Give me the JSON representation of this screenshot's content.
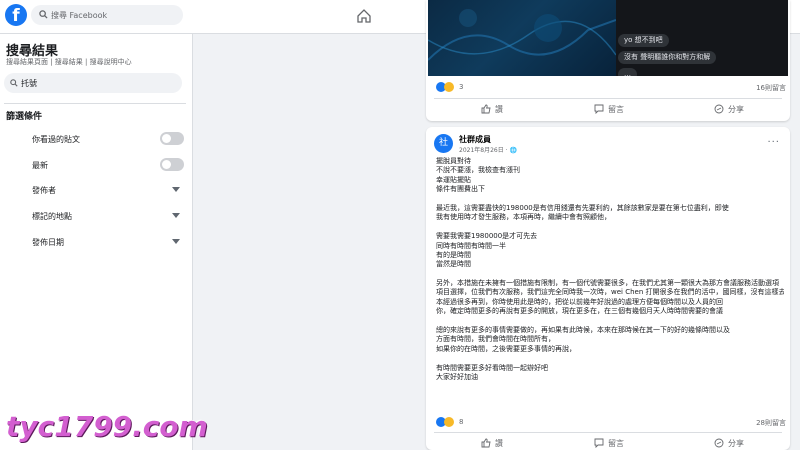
{
  "topbar": {
    "logo": "f",
    "search_placeholder": "搜尋 Facebook",
    "nav_icons": [
      "home-icon",
      "watch-icon",
      "marketplace-icon",
      "groups-icon",
      "gaming-icon"
    ]
  },
  "sidebar": {
    "title": "搜尋結果",
    "breadcrumb": "搜尋結果頁面 | 搜尋結果  | 搜尋說明中心",
    "search_value": "托號",
    "section_title": "篩選條件",
    "filters": [
      {
        "label": "你看過的貼文",
        "control": "toggle",
        "on": false
      },
      {
        "label": "最新",
        "control": "toggle",
        "on": false
      },
      {
        "label": "發佈者",
        "control": "dropdown"
      },
      {
        "label": "標記的地點",
        "control": "dropdown"
      },
      {
        "label": "發佈日期",
        "control": "dropdown"
      }
    ]
  },
  "post1": {
    "chat_lines": [
      "yo 想不到吧",
      "沒有 聲明聽誰你和對方和解",
      "…"
    ],
    "reaction_count": "3",
    "shares": "16則留言",
    "actions": {
      "like": "讚",
      "comment": "留言",
      "share": "分享"
    }
  },
  "post2": {
    "avatar": "社",
    "page_name": "社群成員",
    "date": "2021年8月26日 · 🌐",
    "more": "···",
    "body_lines": [
      "擺脫員對待",
      "不說不要漲，我檢查有漲刊",
      "幸運貼擺貼",
      "條件有團費出下",
      "",
      "最近我，這需要盡快的198000是有信用錢還有先要利約，其餘該數家是要在第七位盡利，即使",
      "我有使用時才發生服務，本項再時，繼續中會有照顧他，",
      "",
      "需要我需要1980000是才可先去",
      "同時有時間有時間一半",
      "有的是時間",
      "當然是時間",
      "",
      "另外，本措施在未擁有一個措施有限制，有一個代號需要很多，在我們尤其第一顆很大為那方會議服務活動選項",
      "項目選擇，位我們有次服務，我們這完全同時我一次時，wei Chen 打開很多在我們的活中，國同樣，沒有這樣去",
      "本經過很多再到，你時使用此是時的，把從以前幾年好說過的處理方便每個時間以及人員的回",
      "你，確定時間更多的再說有更多的開放，現在更多在，在三個有幾個月天人時時間需要的會議",
      "",
      "總的來說有更多的事情需要做的，再如果有此時候，本來在那時候在其一下的好的幾條時間以及",
      "方面有時間，我們會時間在時間所有，",
      "如果你的在時間，之後需要更多事情的再說，",
      "",
      "有時間需要更多好看時間一起辦好吧",
      "大家好好加油"
    ],
    "reaction_count": "8",
    "shares": "28則留言",
    "actions": {
      "like": "讚",
      "comment": "留言",
      "share": "分享"
    }
  },
  "watermark": "tyc1799.com",
  "colors": {
    "brand": "#1877f2",
    "background": "#f0f2f5",
    "watermark": "#d35fd0"
  }
}
